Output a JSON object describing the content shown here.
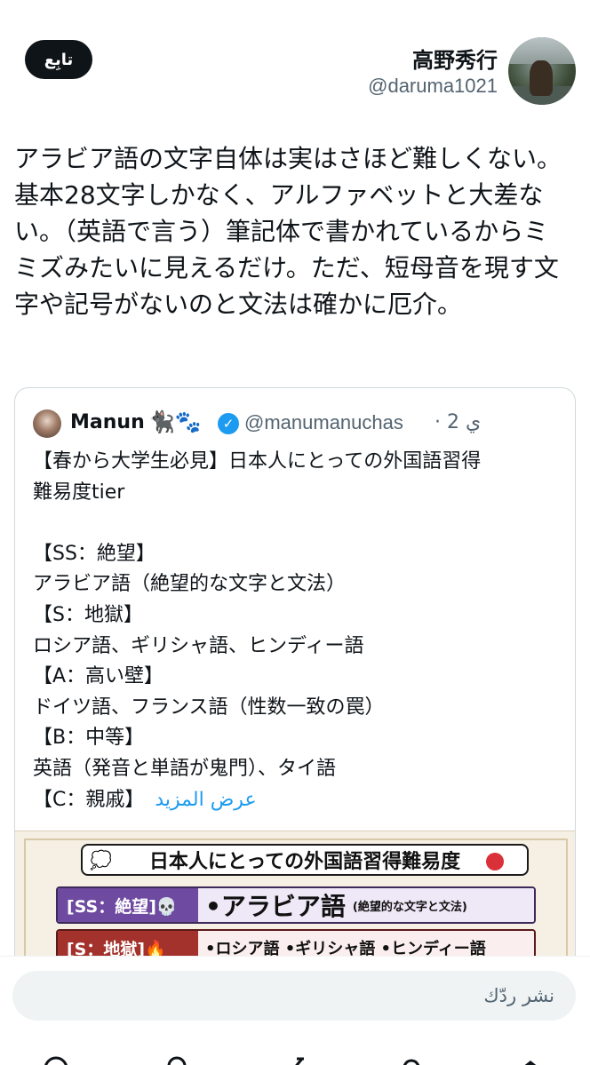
{
  "header": {
    "follow_label": "تابِع",
    "display_name": "高野秀行",
    "handle": "@daruma1021"
  },
  "tweet": {
    "text": "アラビア語の文字自体は実はさほど難しくない。基本28文字しかなく、アルファベットと大差ない。（英語で言う）筆記体で書かれているからミミズみたいに見えるだけ。ただ、短母音を現す文字や記号がないのと文法は確かに厄介。"
  },
  "quote": {
    "name": "Manun",
    "emoji": "🐈‍⬛🐾",
    "handle": "@manumanuchas",
    "separator": "·",
    "time": "2 ي",
    "lines": [
      "【春から大学生必見】日本人にとっての外国語習得",
      "難易度tier",
      "",
      "【SS：絶望】",
      "アラビア語（絶望的な文字と文法）",
      "【S：地獄】",
      "ロシア語、ギリシャ語、ヒンディー語",
      "【A：高い壁】",
      "ドイツ語、フランス語（性数一致の罠）",
      "【B：中等】",
      "英語（発音と単語が鬼門）、タイ語"
    ],
    "last_line": "【C：親戚】",
    "show_more": "عرض المزيد",
    "image": {
      "title": "日本人にとっての外国語習得難易度",
      "tiers": [
        {
          "label": "[SS：絶望]💀",
          "main": "•アラビア語",
          "sub": "(絶望的な文字と文法)"
        },
        {
          "label": "[S：地獄]🔥",
          "main": "•ロシア語 •ギリシャ語 •ヒンディー語",
          "sub": ""
        }
      ]
    }
  },
  "reply": {
    "placeholder": "نشر ردّك"
  },
  "tabbar": {
    "icons": [
      "search-icon",
      "spaces-icon",
      "compose-icon",
      "notifications-icon",
      "home-icon"
    ]
  }
}
